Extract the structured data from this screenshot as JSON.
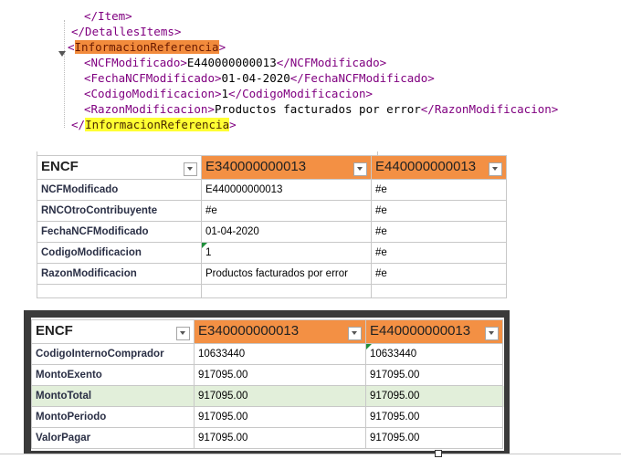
{
  "xml": {
    "lines": [
      "</Item>",
      "</DetallesItems>",
      "InformacionReferencia",
      "<NCFModificado>",
      "E440000000013",
      "</NCFModificado>",
      "<FechaNCFModificado>",
      "01-04-2020",
      "</FechaNCFModificado>",
      "<CodigoModificacion>",
      "1",
      "</CodigoModificacion>",
      "<RazonModificacion>",
      "Productos facturados por error",
      "</RazonModificacion>",
      "InformacionReferencia"
    ],
    "open_lt": "<",
    "open_gt": ">",
    "close_lt": "</",
    "close_gt": ">"
  },
  "table1": {
    "headers": [
      "ENCF",
      "E340000000013",
      "E440000000013"
    ],
    "rows": [
      [
        "NCFModificado",
        "E440000000013",
        "#e"
      ],
      [
        "RNCOtroContribuyente",
        "#e",
        "#e"
      ],
      [
        "FechaNCFModificado",
        "01-04-2020",
        "#e"
      ],
      [
        "CodigoModificacion",
        "1",
        "#e"
      ],
      [
        "RazonModificacion",
        "Productos facturados por error",
        "#e"
      ],
      [
        "",
        "",
        ""
      ]
    ]
  },
  "table2": {
    "headers": [
      "ENCF",
      "E340000000013",
      "E440000000013"
    ],
    "rows": [
      [
        "CodigoInternoComprador",
        "10633440",
        "10633440"
      ],
      [
        "MontoExento",
        "917095.00",
        "917095.00"
      ],
      [
        "MontoTotal",
        "917095.00",
        "917095.00"
      ],
      [
        "MontoPeriodo",
        "917095.00",
        "917095.00"
      ],
      [
        "ValorPagar",
        "917095.00",
        "917095.00"
      ]
    ]
  },
  "colors": {
    "header_orange": "#f39044",
    "highlight_orange": "#f28b3c",
    "highlight_yellow": "#ffff33",
    "selected_row": "#e2efda",
    "xml_tag": "#800080"
  },
  "icons": [
    "dropdown-arrow-icon",
    "filter-icon",
    "collapse-triangle-icon"
  ]
}
